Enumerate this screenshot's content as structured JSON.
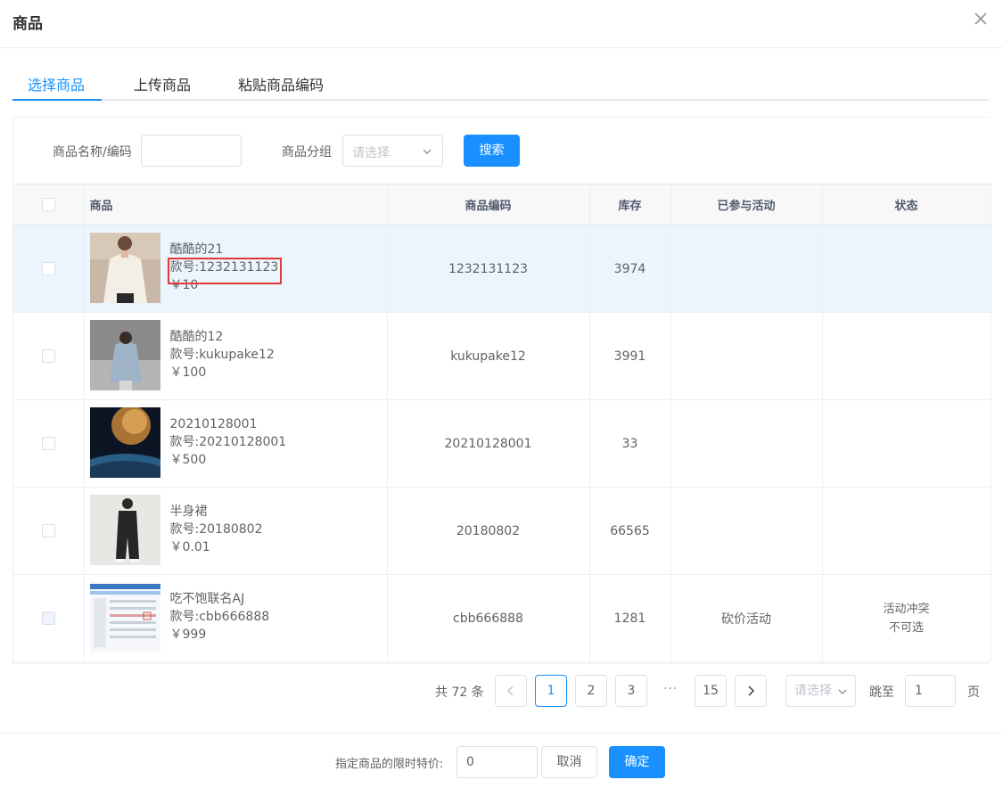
{
  "dialog": {
    "title": "商品"
  },
  "tabs": [
    {
      "label": "选择商品",
      "active": true
    },
    {
      "label": "上传商品",
      "active": false
    },
    {
      "label": "粘贴商品编码",
      "active": false
    }
  ],
  "filters": {
    "name_label": "商品名称/编码",
    "name_value": "",
    "group_label": "商品分组",
    "group_placeholder": "请选择",
    "search_label": "搜索"
  },
  "table": {
    "headers": {
      "product": "商品",
      "code": "商品编码",
      "stock": "库存",
      "activity": "已参与活动",
      "status": "状态"
    },
    "rows": [
      {
        "name": "酷酷的21",
        "sku": "款号:1232131123",
        "price": "￥10",
        "code": "1232131123",
        "stock": "3974",
        "activity": "",
        "status": "",
        "status2": ""
      },
      {
        "name": "酷酷的12",
        "sku": "款号:kukupake12",
        "price": "￥100",
        "code": "kukupake12",
        "stock": "3991",
        "activity": "",
        "status": "",
        "status2": ""
      },
      {
        "name": "20210128001",
        "sku": "款号:20210128001",
        "price": "￥500",
        "code": "20210128001",
        "stock": "33",
        "activity": "",
        "status": "",
        "status2": ""
      },
      {
        "name": "半身裙",
        "sku": "款号:20180802",
        "price": "￥0.01",
        "code": "20180802",
        "stock": "66565",
        "activity": "",
        "status": "",
        "status2": ""
      },
      {
        "name": "吃不饱联名AJ",
        "sku": "款号:cbb666888",
        "price": "￥999",
        "code": "cbb666888",
        "stock": "1281",
        "activity": "砍价活动",
        "status": "活动冲突",
        "status2": "不可选"
      }
    ]
  },
  "pagination": {
    "total": "共 72 条",
    "pages": [
      "1",
      "2",
      "3",
      "15"
    ],
    "current": "1",
    "ellipsis": "···",
    "size_placeholder": "请选择",
    "jump_label": "跳至",
    "jump_value": "1",
    "page_suffix": "页"
  },
  "footer": {
    "price_label": "指定商品的限时特价:",
    "price_value": "0",
    "cancel_label": "取消",
    "confirm_label": "确定"
  },
  "colors": {
    "primary": "#1890ff",
    "highlight_row": "#eaf5fd",
    "annotation_box": "#e53935"
  },
  "icons": [
    "close-icon",
    "chevron-down-icon",
    "chevron-left-icon",
    "chevron-right-icon"
  ]
}
